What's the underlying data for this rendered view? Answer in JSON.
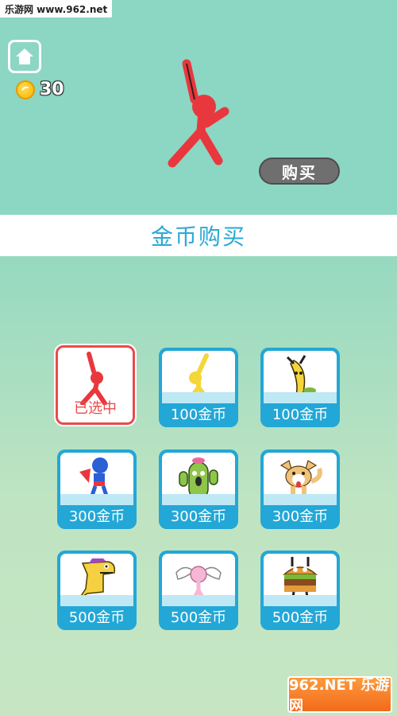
{
  "watermark_top": "乐游网 www.962.net",
  "header": {
    "coin_count": "30",
    "buy_label": "购买"
  },
  "section": {
    "title": "金币购买"
  },
  "cards": [
    {
      "price": "已选中",
      "selected": true
    },
    {
      "price": "100金币"
    },
    {
      "price": "100金币"
    },
    {
      "price": "300金币"
    },
    {
      "price": "300金币"
    },
    {
      "price": "300金币"
    },
    {
      "price": "500金币"
    },
    {
      "price": "500金币"
    },
    {
      "price": "500金币"
    }
  ],
  "watermark_bottom": "962.NET 乐游网",
  "colors": {
    "accent": "#23a7d6",
    "selected_border": "#e94b4b",
    "hero": "#e8383d"
  }
}
